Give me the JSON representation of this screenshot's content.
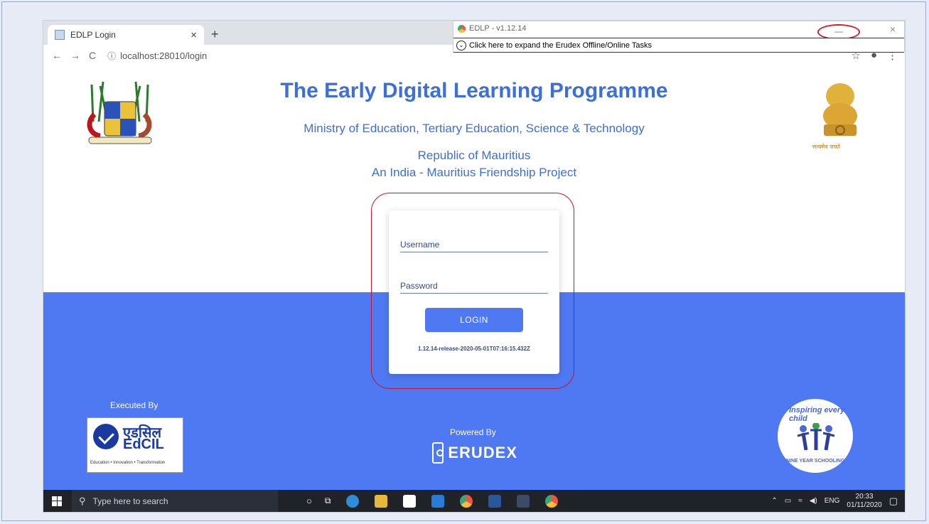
{
  "browser": {
    "tab_title": "EDLP Login",
    "tab_close": "×",
    "new_tab": "+",
    "nav_back": "←",
    "nav_forward": "→",
    "nav_reload": "C",
    "info_icon": "ⓘ",
    "url": "localhost:28010/login"
  },
  "erudex_window": {
    "title": "EDLP - v1.12.14",
    "minimize": "—",
    "close": "×",
    "expand_text": "Click here to expand the Erudex Offline/Online Tasks"
  },
  "page": {
    "title": "The Early Digital Learning Programme",
    "ministry": "Ministry of Education, Tertiary Education, Science & Technology",
    "republic": "Republic of Mauritius",
    "friendship": "An India - Mauritius Friendship Project",
    "india_motto": "सत्यमेव जयते"
  },
  "login": {
    "username_label": "Username",
    "password_label": "Password",
    "button": "LOGIN",
    "version": "1.12.14-release-2020-05-01T07:16:15.432Z"
  },
  "footer": {
    "executed_by": "Executed By",
    "edcil_hindi": "एडसिल",
    "edcil_name": "EdCIL",
    "edcil_tagline": "Education • Innovation • Transformation",
    "powered_by": "Powered By",
    "erudex": "ERUDEX",
    "nys_arc": "Inspiring every child",
    "nys_label": "NINE YEAR SCHOOLING"
  },
  "taskbar": {
    "search_placeholder": "Type here to search",
    "lang": "ENG",
    "time": "20:33",
    "date": "01/11/2020"
  }
}
